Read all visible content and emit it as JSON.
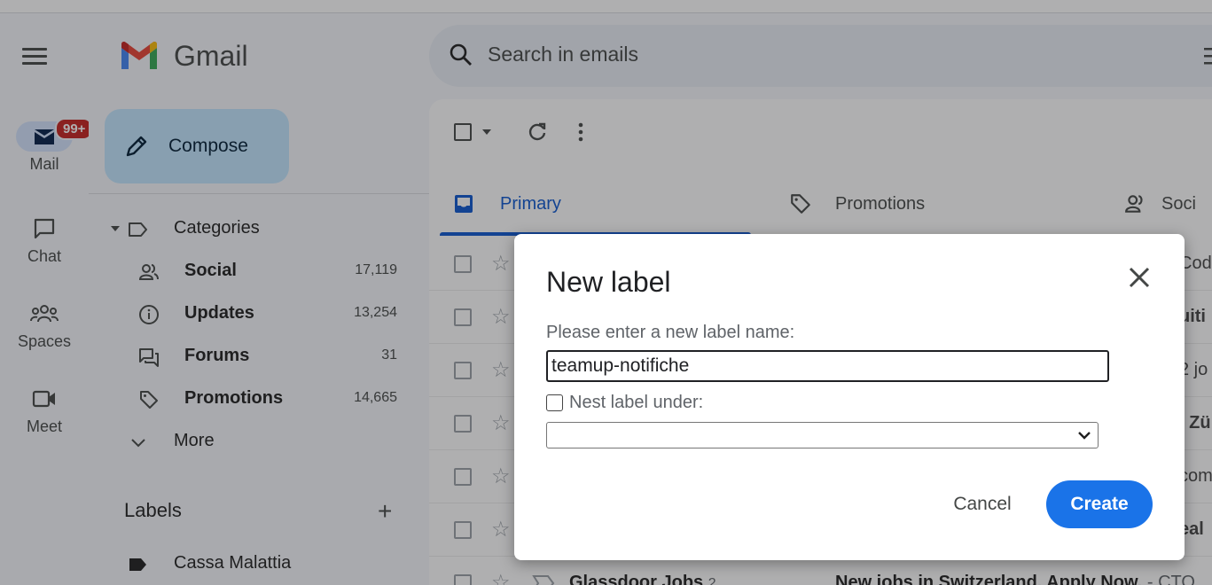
{
  "app": {
    "brand": "Gmail"
  },
  "rail": {
    "badge": "99+",
    "items": [
      {
        "label": "Mail",
        "icon": "mail-icon"
      },
      {
        "label": "Chat",
        "icon": "chat-icon"
      },
      {
        "label": "Spaces",
        "icon": "spaces-icon"
      },
      {
        "label": "Meet",
        "icon": "meet-icon"
      }
    ]
  },
  "sidebar": {
    "compose_label": "Compose",
    "categories_label": "Categories",
    "categories": [
      {
        "label": "Social",
        "count": "17,119",
        "icon": "people-icon"
      },
      {
        "label": "Updates",
        "count": "13,254",
        "icon": "info-icon"
      },
      {
        "label": "Forums",
        "count": "31",
        "icon": "forum-icon"
      },
      {
        "label": "Promotions",
        "count": "14,665",
        "icon": "tag-icon"
      }
    ],
    "more_label": "More",
    "labels_heading": "Labels",
    "labels": [
      {
        "label": "Cassa Malattia"
      }
    ]
  },
  "search": {
    "placeholder": "Search in emails"
  },
  "tabs": [
    {
      "label": "Primary",
      "icon": "inbox-icon"
    },
    {
      "label": "Promotions",
      "icon": "tag-icon"
    },
    {
      "label": "Soci",
      "icon": "people-icon"
    }
  ],
  "mail_rows": [
    {
      "peek": "Cod"
    },
    {
      "peek": "uiti"
    },
    {
      "peek": "2 jo"
    },
    {
      "peek": "i Zü"
    },
    {
      "peek": "com"
    },
    {
      "peek": "eal"
    },
    {
      "sender": "Glassdoor Jobs",
      "count": "2",
      "subject": "New jobs in Switzerland. Apply Now.",
      "snippet": " - CTO"
    }
  ],
  "dialog": {
    "title": "New label",
    "prompt": "Please enter a new label name:",
    "input_value": "teamup-notifiche",
    "nest_label": "Nest label under:",
    "cancel_label": "Cancel",
    "create_label": "Create"
  },
  "colors": {
    "accent": "#0b57d0",
    "create_button": "#1a73e8",
    "badge": "#c5221f",
    "compose": "#c2e7ff"
  }
}
